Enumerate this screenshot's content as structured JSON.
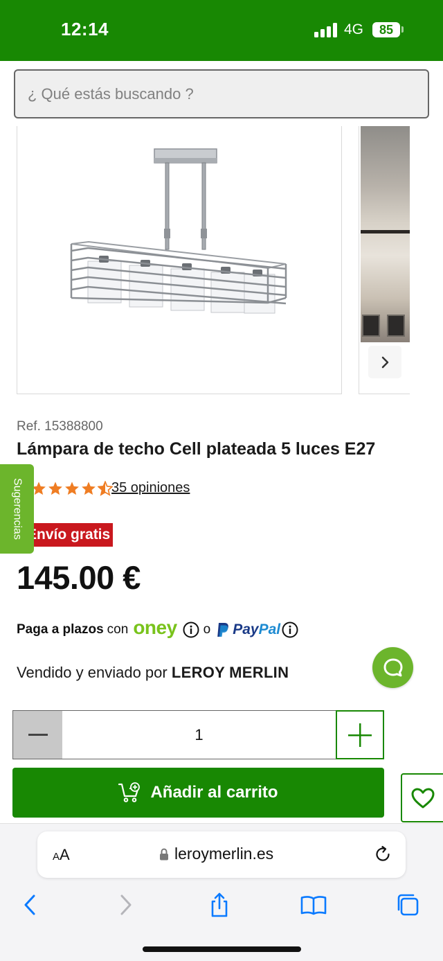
{
  "status_bar": {
    "time": "12:14",
    "network": "4G",
    "battery": "85",
    "colors": {
      "background": "#188803"
    }
  },
  "search": {
    "placeholder": "¿ Qué estás buscando ?",
    "value": ""
  },
  "gallery": {
    "icons": {
      "next": "chevron-right-icon"
    }
  },
  "product": {
    "ref": "Ref. 15388800",
    "title": "Lámpara de techo Cell plateada 5 luces E27",
    "rating": {
      "value": 4.5,
      "max": 5,
      "reviews_label": "35 opiniones"
    },
    "badge": "Envío gratis",
    "price": "145.00 €",
    "payment": {
      "prefix": "Paga a plazos",
      "connector": "con",
      "provider_1": "oney",
      "separator": "o",
      "provider_2_a": "Pay",
      "provider_2_b": "Pal"
    },
    "seller_prefix": "Vendido y enviado por",
    "seller_name": "LEROY MERLIN"
  },
  "sidebar_tab": {
    "label": "Sugerencias"
  },
  "quantity": {
    "value": "1"
  },
  "cart": {
    "label": "Añadir al carrito"
  },
  "browser": {
    "aa_label": "A",
    "aa_small": "A",
    "url": "leroymerlin.es"
  },
  "colors": {
    "brand_green": "#188803",
    "light_green": "#6cb52c",
    "badge_red": "#c9181e",
    "star_orange": "#ef7d23",
    "oney_green": "#79c31c",
    "ios_blue": "#0a7aff"
  }
}
